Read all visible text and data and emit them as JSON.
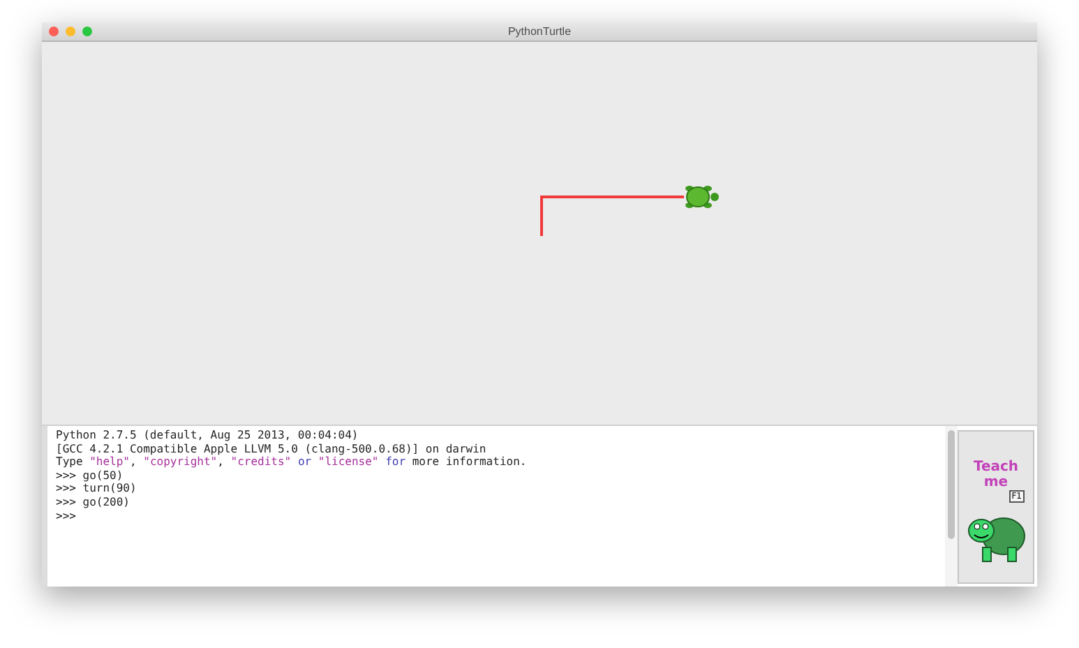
{
  "window": {
    "title": "PythonTurtle"
  },
  "console": {
    "lines": [
      [
        {
          "text": "Python 2.7.5 (default, Aug 25 2013, 00:04:04)",
          "kind": "plain"
        }
      ],
      [
        {
          "text": "[GCC 4.2.1 Compatible Apple LLVM 5.0 (clang-500.0.68)] on darwin",
          "kind": "plain"
        }
      ],
      [
        {
          "text": "Type ",
          "kind": "plain"
        },
        {
          "text": "\"help\"",
          "kind": "string"
        },
        {
          "text": ", ",
          "kind": "plain"
        },
        {
          "text": "\"copyright\"",
          "kind": "string"
        },
        {
          "text": ", ",
          "kind": "plain"
        },
        {
          "text": "\"credits\"",
          "kind": "string"
        },
        {
          "text": "or",
          "kind": "keyword"
        },
        {
          "text": "\"license\"",
          "kind": "string"
        },
        {
          "text": "for",
          "kind": "keyword"
        },
        {
          "text": "more information.",
          "kind": "plain"
        }
      ],
      [
        {
          "text": ">>> go(50)",
          "kind": "plain"
        }
      ],
      [
        {
          "text": ">>> turn(90)",
          "kind": "plain"
        }
      ],
      [
        {
          "text": ">>> go(200)",
          "kind": "plain"
        }
      ],
      [
        {
          "text": ">>>",
          "kind": "plain"
        }
      ]
    ]
  },
  "teach_button": {
    "line_1": "Teach",
    "line_2": "me",
    "key": "F1"
  }
}
